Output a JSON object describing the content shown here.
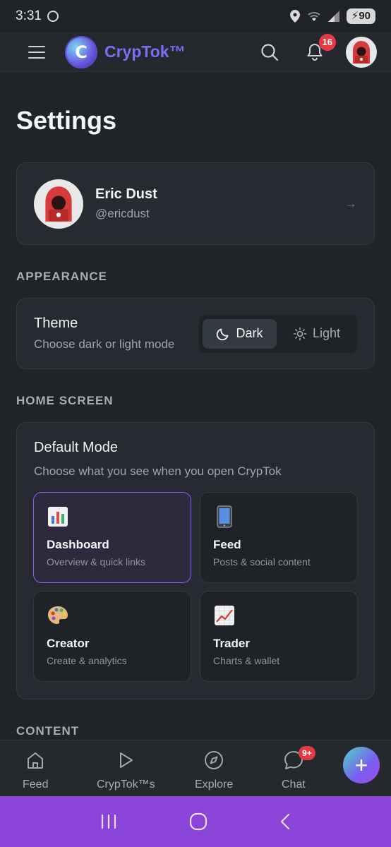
{
  "status_bar": {
    "time": "3:31",
    "battery": "90"
  },
  "app_bar": {
    "brand": "CrypTok™",
    "logo_letter": "C",
    "notification_count": "16"
  },
  "page": {
    "title": "Settings"
  },
  "profile": {
    "name": "Eric Dust",
    "handle": "@ericdust",
    "arrow": "→"
  },
  "appearance": {
    "section_label": "APPEARANCE",
    "theme_title": "Theme",
    "theme_desc": "Choose dark or light mode",
    "options": [
      {
        "label": "Dark",
        "selected": true
      },
      {
        "label": "Light",
        "selected": false
      }
    ]
  },
  "home_screen": {
    "section_label": "HOME SCREEN",
    "mode_title": "Default Mode",
    "mode_desc": "Choose what you see when you open CrypTok",
    "modes": [
      {
        "title": "Dashboard",
        "subtitle": "Overview & quick links",
        "icon": "bar-chart-icon",
        "selected": true
      },
      {
        "title": "Feed",
        "subtitle": "Posts & social content",
        "icon": "mobile-phone-icon",
        "selected": false
      },
      {
        "title": "Creator",
        "subtitle": "Create & analytics",
        "icon": "palette-icon",
        "selected": false
      },
      {
        "title": "Trader",
        "subtitle": "Charts & wallet",
        "icon": "trending-up-chart-icon",
        "selected": false
      }
    ]
  },
  "content_section": {
    "section_label": "CONTENT"
  },
  "bottom_nav": {
    "items": [
      {
        "label": "Feed",
        "icon": "home-icon"
      },
      {
        "label": "CrypTok™s",
        "icon": "play-icon"
      },
      {
        "label": "Explore",
        "icon": "compass-icon"
      },
      {
        "label": "Chat",
        "icon": "chat-bubble-icon",
        "badge": "9+"
      }
    ],
    "fab_label": "+"
  },
  "colors": {
    "background": "#202327",
    "card": "#272a30",
    "accent": "#8b5cf6",
    "brand": "#7c6df2",
    "badge": "#e53945",
    "system_nav": "#8a44d8"
  }
}
